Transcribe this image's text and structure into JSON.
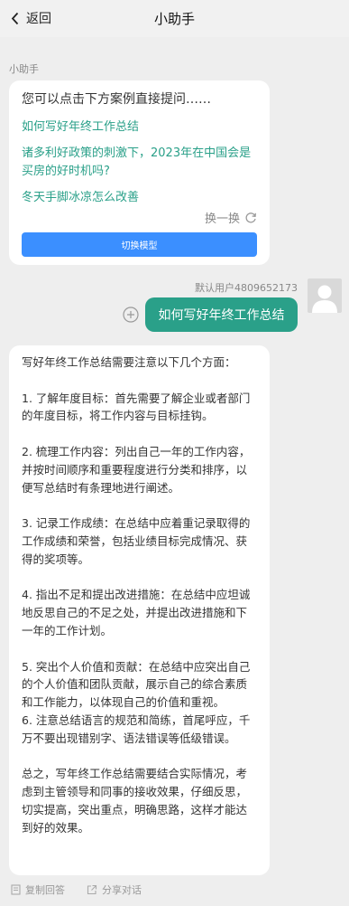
{
  "header": {
    "back_label": "返回",
    "title": "小助手"
  },
  "bot": {
    "name": "小助手"
  },
  "intro": {
    "text": "您可以点击下方案例直接提问……",
    "suggestions": [
      "如何写好年终工作总结",
      "诸多利好政策的刺激下，2023年在中国会是买房的好时机吗?",
      "冬天手脚冰凉怎么改善"
    ],
    "refresh_label": "换一换",
    "switch_model_label": "切换模型"
  },
  "user": {
    "name": "默认用户4809652173",
    "message": "如何写好年终工作总结"
  },
  "answer": {
    "text": "写好年终工作总结需要注意以下几个方面：\n\n1. 了解年度目标：首先需要了解企业或者部门的年度目标，将工作内容与目标挂钩。\n\n2. 梳理工作内容：列出自己一年的工作内容，并按时间顺序和重要程度进行分类和排序，以便写总结时有条理地进行阐述。\n\n3. 记录工作成绩：在总结中应着重记录取得的工作成绩和荣誉，包括业绩目标完成情况、获得的奖项等。\n\n4. 指出不足和提出改进措施：在总结中应坦诚地反思自己的不足之处，并提出改进措施和下一年的工作计划。\n\n5. 突出个人价值和贡献：在总结中应突出自己的个人价值和团队贡献，展示自己的综合素质和工作能力，以体现自己的价值和重视。\n6. 注意总结语言的规范和简练，首尾呼应，千万不要出现错别字、语法错误等低级错误。\n\n总之，写年终工作总结需要结合实际情况，考虑到主管领导和同事的接收效果，仔细反思，切实提高，突出重点，明确思路，这样才能达到好的效果。"
  },
  "actions": {
    "copy_label": "复制回答",
    "share_label": "分享对话"
  },
  "colors": {
    "accent": "#2aa089",
    "button_blue": "#3b8fff",
    "background": "#eeeeee"
  }
}
